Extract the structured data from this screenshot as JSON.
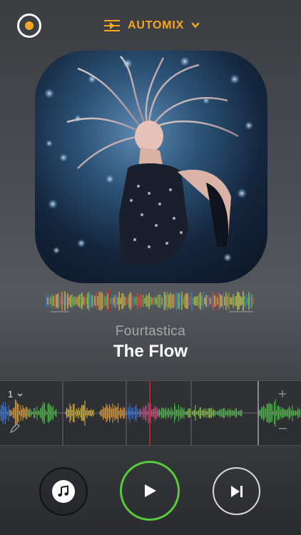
{
  "header": {
    "record_icon": "record-icon",
    "mode_icon": "automix-list-icon",
    "mode_label": "AUTOMIX",
    "mode_dropdown_icon": "chevron-down-icon",
    "accent_color": "#f5a623"
  },
  "now_playing": {
    "artwork_icon": "album-artwork",
    "artist": "Fourtastica",
    "title": "The Flow"
  },
  "timeline": {
    "beat_marker": "1",
    "pencil_icon": "pencil-icon",
    "zoom_in_label": "+",
    "zoom_out_label": "−",
    "playhead_color": "#e02020"
  },
  "controls": {
    "music_icon": "music-note-icon",
    "play_icon": "play-icon",
    "next_icon": "skip-next-icon",
    "play_ring_color": "#57cb39"
  }
}
